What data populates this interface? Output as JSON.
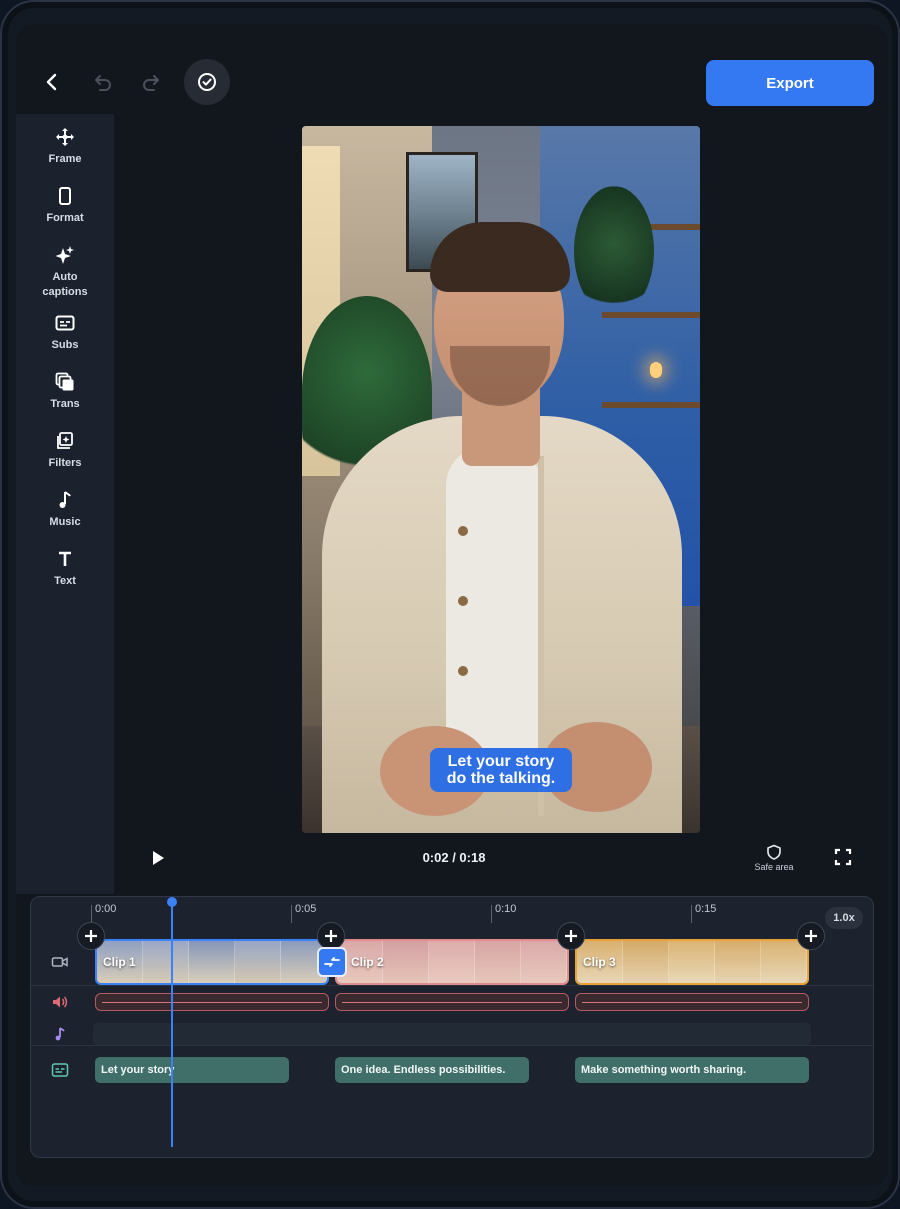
{
  "toolbar": {
    "export_label": "Export"
  },
  "sidebar": {
    "items": [
      {
        "label": "Frame",
        "icon": "move-icon"
      },
      {
        "label": "Format",
        "icon": "phone-frame-icon"
      },
      {
        "label": "Auto captions",
        "icon": "sparkle-icon"
      },
      {
        "label": "Subs",
        "icon": "subtitles-icon"
      },
      {
        "label": "Trans",
        "icon": "transition-icon"
      },
      {
        "label": "Filters",
        "icon": "filter-icon"
      },
      {
        "label": "Music",
        "icon": "music-note-icon"
      },
      {
        "label": "Text",
        "icon": "text-icon"
      }
    ]
  },
  "preview": {
    "caption_text": "Let your story do the talking."
  },
  "playback": {
    "timecode": "0:02 / 0:18",
    "safe_area_label": "Safe area"
  },
  "timeline": {
    "ruler": [
      "0:00",
      "0:05",
      "0:10",
      "0:15"
    ],
    "speed": "1.0x",
    "clips": [
      {
        "label": "Clip 1",
        "color": "#3b82f6"
      },
      {
        "label": "Clip 2",
        "color": "#e08c8c"
      },
      {
        "label": "Clip 3",
        "color": "#e8a23a"
      }
    ],
    "subtitles": [
      "Let your story",
      "One idea. Endless possibilities.",
      "Make something worth sharing."
    ]
  },
  "colors": {
    "accent": "#3478f2",
    "subtitle_track": "#3f6f68",
    "audio_track": "#b45a62"
  }
}
